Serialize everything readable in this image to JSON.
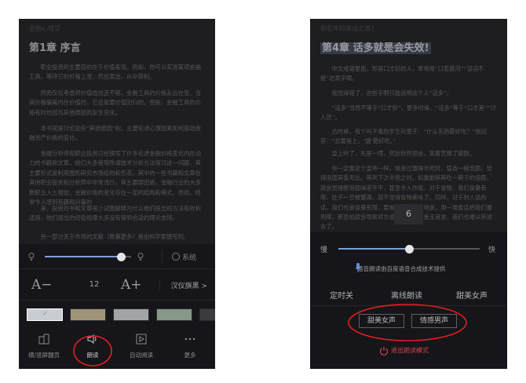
{
  "left_screen": {
    "book_title": "金融心理学",
    "chapter_title": "第1章 序言",
    "paragraphs": [
      "职业投资的主要目的在于价值发现。例如，你可以买进某项金融工具，等待它的价格上涨，然后卖出，从中获利。",
      "然而仅仅考虑到价值低估还不够。金融工具的价格永远在变，当其价格偏离内在价值时，它总是要价值回归的，但是，金融工具的价格有时也因为其他原因而发生变化。",
      "本书就是讨论这些“其他原因”的，主要论述心理因素如何驱动金融资产价格的变化。",
      "金融分析师和职业投资已经撰写了许多论述金融价格变化内在动力的书籍和文章，他们大多使用所谓技术分析方法探讨这一问题，其主要形式是利用图形研究市场结构和形态，其中的一些书籍和文章在其他职业投资和分析师中非常流行，其主要原因是，金融行业的大多数职业人士相信，金融价格的变化存在一定的结构和模式，然而，经常令人感到有趣和兴奋的",
      "是，投民的书和文章很少试图解释为什么他们提出的方法有效和适用，他们提出的经验规律大多没有得到合适的理论支持。",
      "另一部分关于市场的文献（数量更多）是由科学家撰写的。"
    ],
    "brightness": {
      "level": 0.88,
      "system_label": "系统"
    },
    "font": {
      "decrease_label": "A−",
      "size_value": "12",
      "increase_label": "A+",
      "face_label": "汉仪旗黑 >"
    },
    "themes": [
      {
        "color": "#c9ccd3",
        "selected": true,
        "check": "✓"
      },
      {
        "color": "#a09378",
        "selected": false
      },
      {
        "color": "#a2a4a8",
        "selected": false
      },
      {
        "color": "#889886",
        "selected": false
      },
      {
        "color": "#3a3c3e",
        "selected": false
      }
    ],
    "tabs": [
      {
        "label": "横/竖屏翻页",
        "icon": "page-flip-icon"
      },
      {
        "label": "朗读",
        "icon": "speaker-icon",
        "active": true
      },
      {
        "label": "自动阅读",
        "icon": "play-icon"
      },
      {
        "label": "更多",
        "icon": "more-icon"
      }
    ]
  },
  "right_screen": {
    "book_title": "那些年的说话之道2",
    "chapter_title": "第4章 话多就是会失效!",
    "paragraphs": [
      "中文成语里面，形容口才好的人，常常用“口若悬河”“滔滔不绝”这类字眼。",
      "我觉得错了，这些字眼只能说明这个人“话多”。",
      "“话多”当然不等于“口才好”，更多时候，“话多”等于“口才差”“讨人厌”。",
      "古时候，有个叫子禽的学生问墨子：“什么东西最好吃？”他回答：“总要是上，‘饿’最好吃。”",
      "皇上听了，先是一愣，然后欣然领会，笑着赏赐了御厨。",
      "你一定像这个皇帝一样，体会过饿得半死时，猛吞一碗泡面，觉得泡面其香无比。等到下次半饱之时，如果能够再吃一碗子的泡面，就会觉得那泡面味道平平，甚至令人作呕。对于食物，我们食量有限，肚子一旦被塞满，就不觉得食物美味了。同样，对于别人说的话，我们也是食量有限，要是有机会不停地说，用一堆废话把我们塞到撑，那恐怕就会导致对方说出吃掉一只金玉良言，我们也难以听进去了。"
    ],
    "speed": {
      "slow_label": "慢",
      "fast_label": "快",
      "value": "6",
      "level": 0.5
    },
    "tts_note": "语音朗读由百度语音合成技术提供",
    "voice_options": [
      "定时关",
      "离线朗读",
      "甜美女声"
    ],
    "voice_types": [
      {
        "label": "甜美女声",
        "selected": true
      },
      {
        "label": "情感男声",
        "selected": false
      }
    ],
    "exit_label": "退出朗读模式",
    "colors": {
      "exit_red": "#d0414d",
      "annotation_red": "#e02020",
      "slider_blue": "#7ea0d8"
    }
  }
}
